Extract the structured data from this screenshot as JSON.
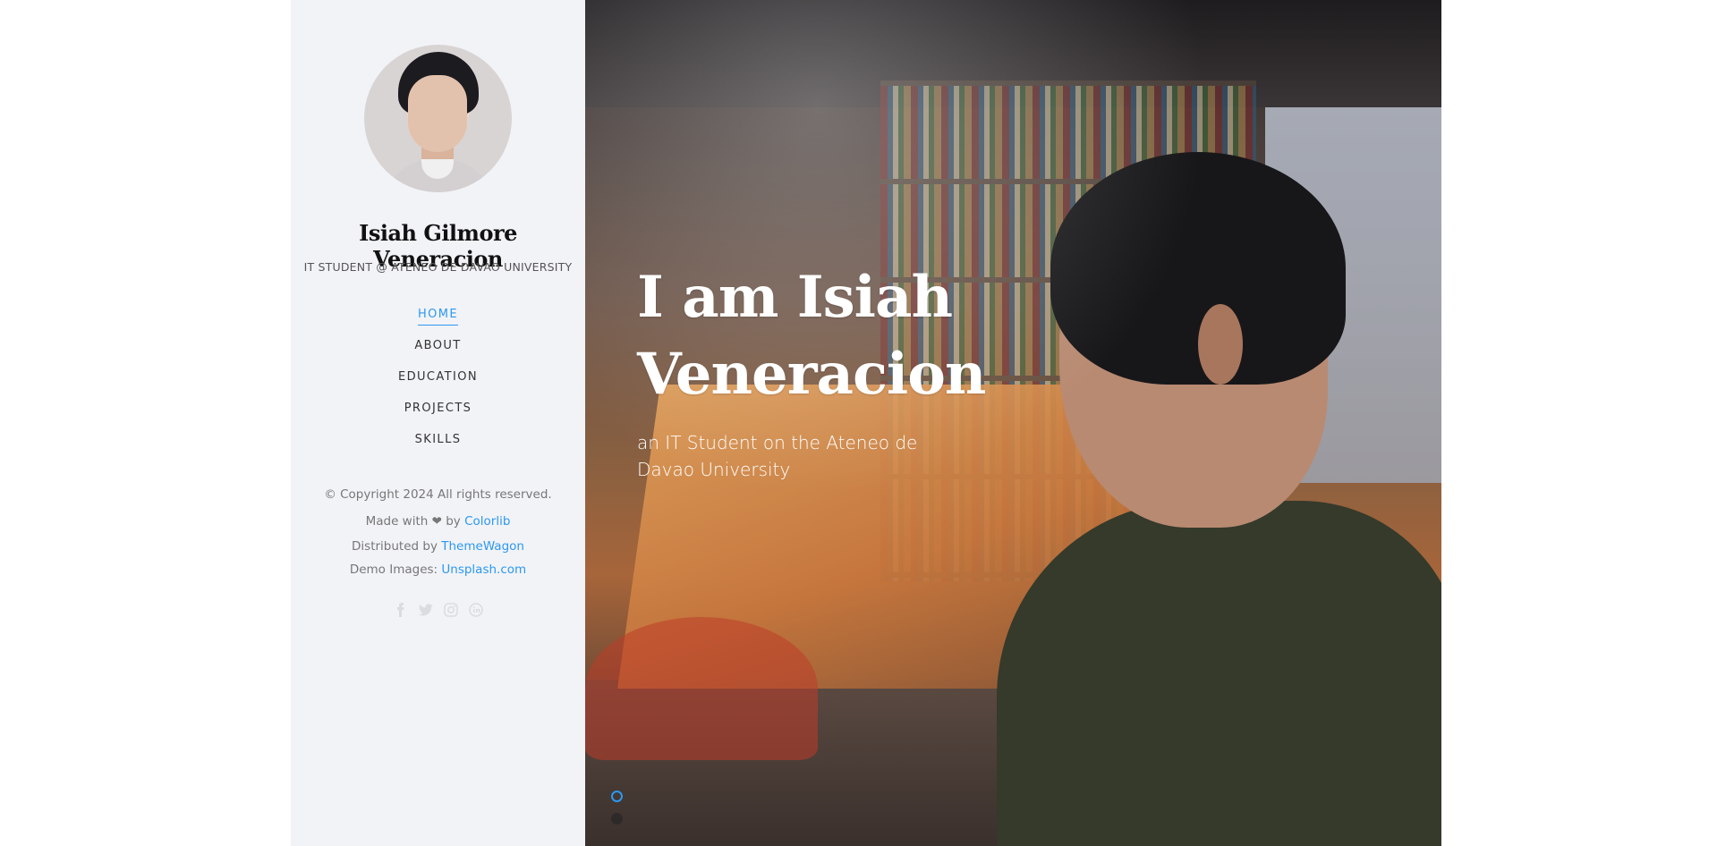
{
  "profile": {
    "name": "Isiah Gilmore Veneracion",
    "tagline": "IT STUDENT @ ATENEO DE DAVAO UNIVERSITY"
  },
  "nav": {
    "items": [
      {
        "label": "HOME",
        "active": true
      },
      {
        "label": "ABOUT",
        "active": false
      },
      {
        "label": "EDUCATION",
        "active": false
      },
      {
        "label": "PROJECTS",
        "active": false
      },
      {
        "label": "SKILLS",
        "active": false
      }
    ]
  },
  "footer": {
    "copyright_pre": "© Copyright 2024 All rights reserved. Made with ❤ by ",
    "colorlib": "Colorlib",
    "distributed_pre": "Distributed by ",
    "themewagon": "ThemeWagon",
    "images_pre": "Demo Images: ",
    "unsplash": "Unsplash.com"
  },
  "social": [
    "facebook-icon",
    "twitter-icon",
    "instagram-icon",
    "linkedin-icon"
  ],
  "hero": {
    "title": "I am Isiah Veneracion",
    "subtitle": "an IT Student on the Ateneo de Davao University"
  },
  "slider": {
    "count": 2,
    "active_index": 0
  },
  "colors": {
    "accent": "#2c98f0",
    "sidebar_bg": "#f2f3f7"
  }
}
